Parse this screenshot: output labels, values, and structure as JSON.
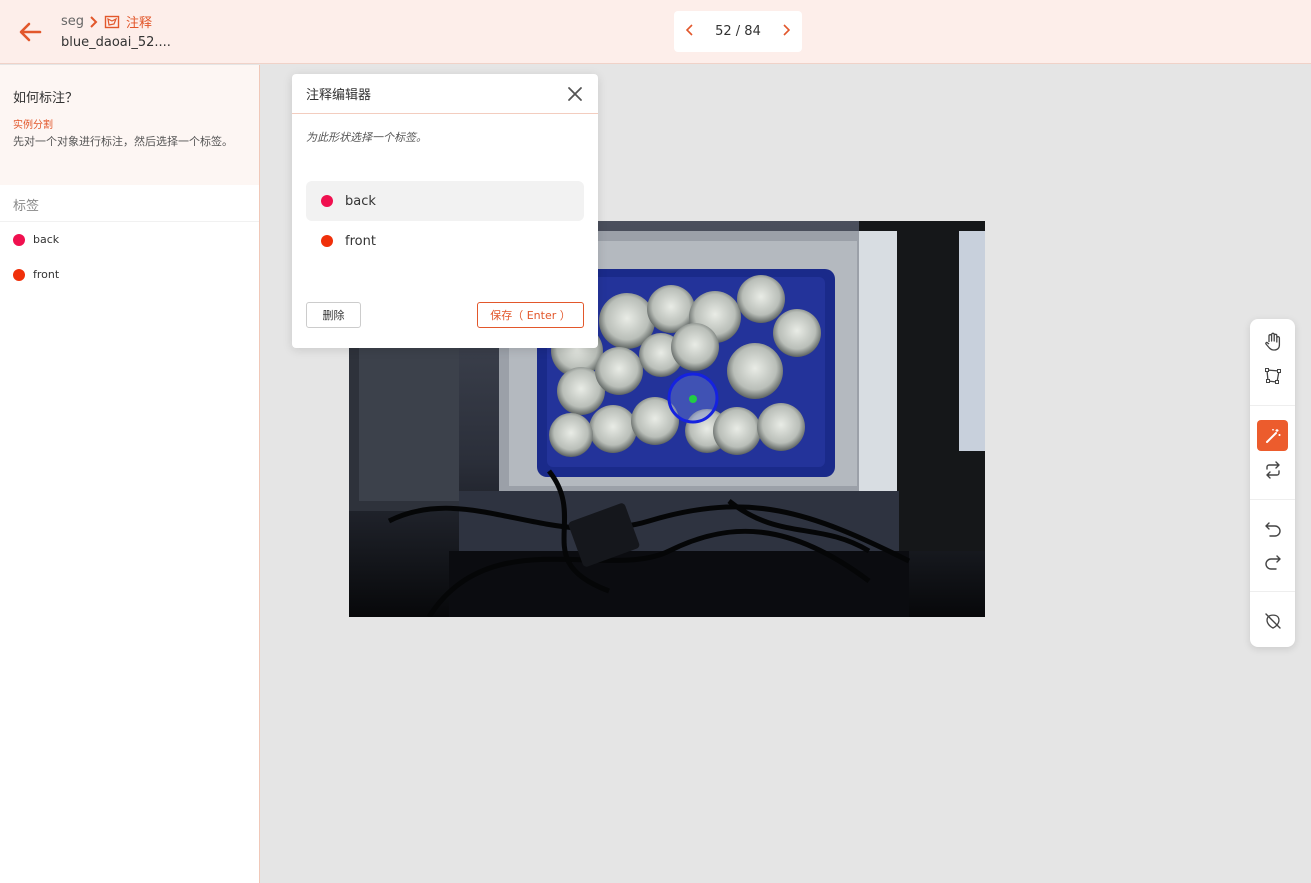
{
  "header": {
    "breadcrumb_root": "seg",
    "breadcrumb_current": "注释",
    "filename": "blue_daoai_52....",
    "pager": {
      "current": 52,
      "total": 84,
      "text": "52 / 84"
    }
  },
  "sidebar": {
    "howto_title": "如何标注？",
    "howto_subtitle": "实例分割",
    "howto_text": "先对一个对象进行标注，然后选择一个标签。",
    "labels_heading": "标签",
    "labels": [
      {
        "name": "back",
        "color": "#f0104f"
      },
      {
        "name": "front",
        "color": "#f0300a"
      }
    ]
  },
  "dialog": {
    "title": "注释编辑器",
    "hint": "为此形状选择一个标签。",
    "options": [
      {
        "name": "back",
        "color": "#f0104f",
        "selected": true
      },
      {
        "name": "front",
        "color": "#f0300a",
        "selected": false
      }
    ],
    "delete_label": "删除",
    "save_label": "保存（ Enter ）"
  },
  "tools": [
    {
      "name": "hand-tool",
      "icon": "hand-icon",
      "active": false
    },
    {
      "name": "polygon-tool",
      "icon": "polygon-icon",
      "active": false
    },
    {
      "name": "magic-wand-tool",
      "icon": "magic-wand-icon",
      "active": true
    },
    {
      "name": "swap-tool",
      "icon": "swap-icon",
      "active": false
    },
    {
      "name": "undo-tool",
      "icon": "undo-icon",
      "active": false
    },
    {
      "name": "redo-tool",
      "icon": "redo-icon",
      "active": false
    },
    {
      "name": "hide-tool",
      "icon": "eye-off-icon",
      "active": false
    }
  ],
  "colors": {
    "accent": "#e2572b",
    "header_bg": "#fdeeea"
  }
}
